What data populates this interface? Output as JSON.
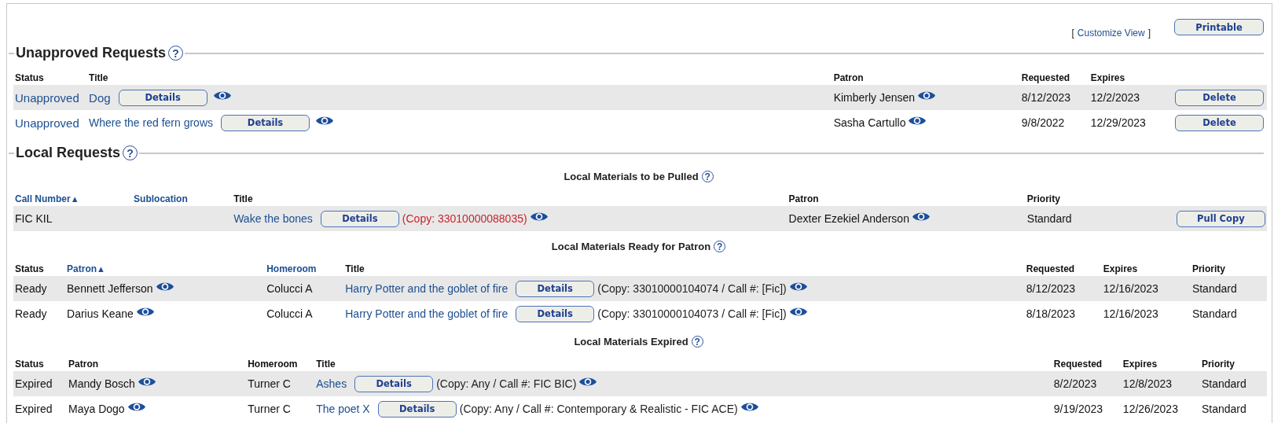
{
  "toolbar": {
    "customize_view": {
      "open": "[",
      "label": "Customize View",
      "close": "]"
    },
    "printable": "Printable"
  },
  "sections": [
    {
      "title": "Unapproved Requests",
      "help": "?",
      "tables": [
        {
          "columns": [
            {
              "label": "Status",
              "link": false
            },
            {
              "label": "Title",
              "link": false
            },
            {
              "label": "Patron",
              "link": false
            },
            {
              "label": "Requested",
              "link": false
            },
            {
              "label": "Expires",
              "link": false
            }
          ],
          "rows": [
            {
              "cells": [
                {
                  "kind": "link",
                  "text": "Unapproved"
                },
                {
                  "kind": "title",
                  "text": "Dog",
                  "button": "Details"
                },
                {
                  "kind": "patron",
                  "text": "Kimberly Jensen"
                },
                {
                  "kind": "text",
                  "text": "8/12/2023"
                },
                {
                  "kind": "text",
                  "text": "12/2/2023"
                },
                {
                  "kind": "button",
                  "text": "Delete"
                }
              ]
            },
            {
              "cells": [
                {
                  "kind": "link",
                  "text": "Unapproved"
                },
                {
                  "kind": "title",
                  "text": "Where the red fern grows",
                  "button": "Details"
                },
                {
                  "kind": "patron",
                  "text": "Sasha Cartullo"
                },
                {
                  "kind": "text",
                  "text": "9/8/2022"
                },
                {
                  "kind": "text",
                  "text": "12/29/2023"
                },
                {
                  "kind": "button",
                  "text": "Delete"
                }
              ]
            }
          ]
        }
      ]
    },
    {
      "title": "Local Requests",
      "help": "?",
      "tables": [
        {
          "heading": "Local Materials to be Pulled",
          "help": "?",
          "columns": [
            {
              "label": "Call Number",
              "link": true,
              "sort": "▲"
            },
            {
              "label": "Sublocation",
              "link": true
            },
            {
              "label": "Title",
              "link": false
            },
            {
              "label": "Patron",
              "link": false
            },
            {
              "label": "Priority",
              "link": false
            }
          ],
          "rows": [
            {
              "cells": [
                {
                  "kind": "text",
                  "text": "FIC KIL"
                },
                {
                  "kind": "empty"
                },
                {
                  "kind": "title",
                  "text": "Wake the bones",
                  "button": "Details",
                  "copy": "(Copy: 33010000088035)",
                  "copy_alert": true
                },
                {
                  "kind": "patron",
                  "text": "Dexter Ezekiel Anderson"
                },
                {
                  "kind": "text",
                  "text": "Standard"
                },
                {
                  "kind": "button",
                  "text": "Pull Copy"
                }
              ]
            }
          ]
        },
        {
          "heading": "Local Materials Ready for Patron",
          "help": "?",
          "columns": [
            {
              "label": "Status",
              "link": false
            },
            {
              "label": "Patron",
              "link": true,
              "sort": "▲"
            },
            {
              "label": "Homeroom",
              "link": true
            },
            {
              "label": "Title",
              "link": false
            },
            {
              "label": "Requested",
              "link": false
            },
            {
              "label": "Expires",
              "link": false
            },
            {
              "label": "Priority",
              "link": false
            }
          ],
          "rows": [
            {
              "cells": [
                {
                  "kind": "text",
                  "text": "Ready"
                },
                {
                  "kind": "patron",
                  "text": "Bennett Jefferson"
                },
                {
                  "kind": "text",
                  "text": "Colucci A"
                },
                {
                  "kind": "title",
                  "text": "Harry Potter and the goblet of fire",
                  "button": "Details",
                  "copy": "(Copy: 33010000104074 / Call #: [Fic])",
                  "copy_alert": false
                },
                {
                  "kind": "text",
                  "text": "8/12/2023"
                },
                {
                  "kind": "text",
                  "text": "12/16/2023"
                },
                {
                  "kind": "text",
                  "text": "Standard"
                }
              ]
            },
            {
              "cells": [
                {
                  "kind": "text",
                  "text": "Ready"
                },
                {
                  "kind": "patron",
                  "text": "Darius Keane"
                },
                {
                  "kind": "text",
                  "text": "Colucci A"
                },
                {
                  "kind": "title",
                  "text": "Harry Potter and the goblet of fire",
                  "button": "Details",
                  "copy": "(Copy: 33010000104073 / Call #: [Fic])",
                  "copy_alert": false
                },
                {
                  "kind": "text",
                  "text": "8/18/2023"
                },
                {
                  "kind": "text",
                  "text": "12/16/2023"
                },
                {
                  "kind": "text",
                  "text": "Standard"
                }
              ]
            }
          ]
        },
        {
          "heading": "Local Materials Expired",
          "help": "?",
          "columns": [
            {
              "label": "Status",
              "link": false
            },
            {
              "label": "Patron",
              "link": false
            },
            {
              "label": "Homeroom",
              "link": false
            },
            {
              "label": "Title",
              "link": false
            },
            {
              "label": "Requested",
              "link": false
            },
            {
              "label": "Expires",
              "link": false
            },
            {
              "label": "Priority",
              "link": false
            }
          ],
          "rows": [
            {
              "cells": [
                {
                  "kind": "text",
                  "text": "Expired"
                },
                {
                  "kind": "patron",
                  "text": "Mandy Bosch"
                },
                {
                  "kind": "text",
                  "text": "Turner C"
                },
                {
                  "kind": "title",
                  "text": "Ashes",
                  "button": "Details",
                  "copy": "(Copy: Any / Call #: FIC BIC)",
                  "copy_alert": false
                },
                {
                  "kind": "text",
                  "text": "8/2/2023"
                },
                {
                  "kind": "text",
                  "text": "12/8/2023"
                },
                {
                  "kind": "text",
                  "text": "Standard"
                }
              ]
            },
            {
              "cells": [
                {
                  "kind": "text",
                  "text": "Expired"
                },
                {
                  "kind": "patron",
                  "text": "Maya Dogo"
                },
                {
                  "kind": "text",
                  "text": "Turner C"
                },
                {
                  "kind": "title",
                  "text": "The poet X",
                  "button": "Details",
                  "copy": "(Copy: Any / Call #: Contemporary & Realistic - FIC ACE)",
                  "copy_alert": false
                },
                {
                  "kind": "text",
                  "text": "9/19/2023"
                },
                {
                  "kind": "text",
                  "text": "12/26/2023"
                },
                {
                  "kind": "text",
                  "text": "Standard"
                }
              ]
            }
          ]
        }
      ]
    }
  ]
}
